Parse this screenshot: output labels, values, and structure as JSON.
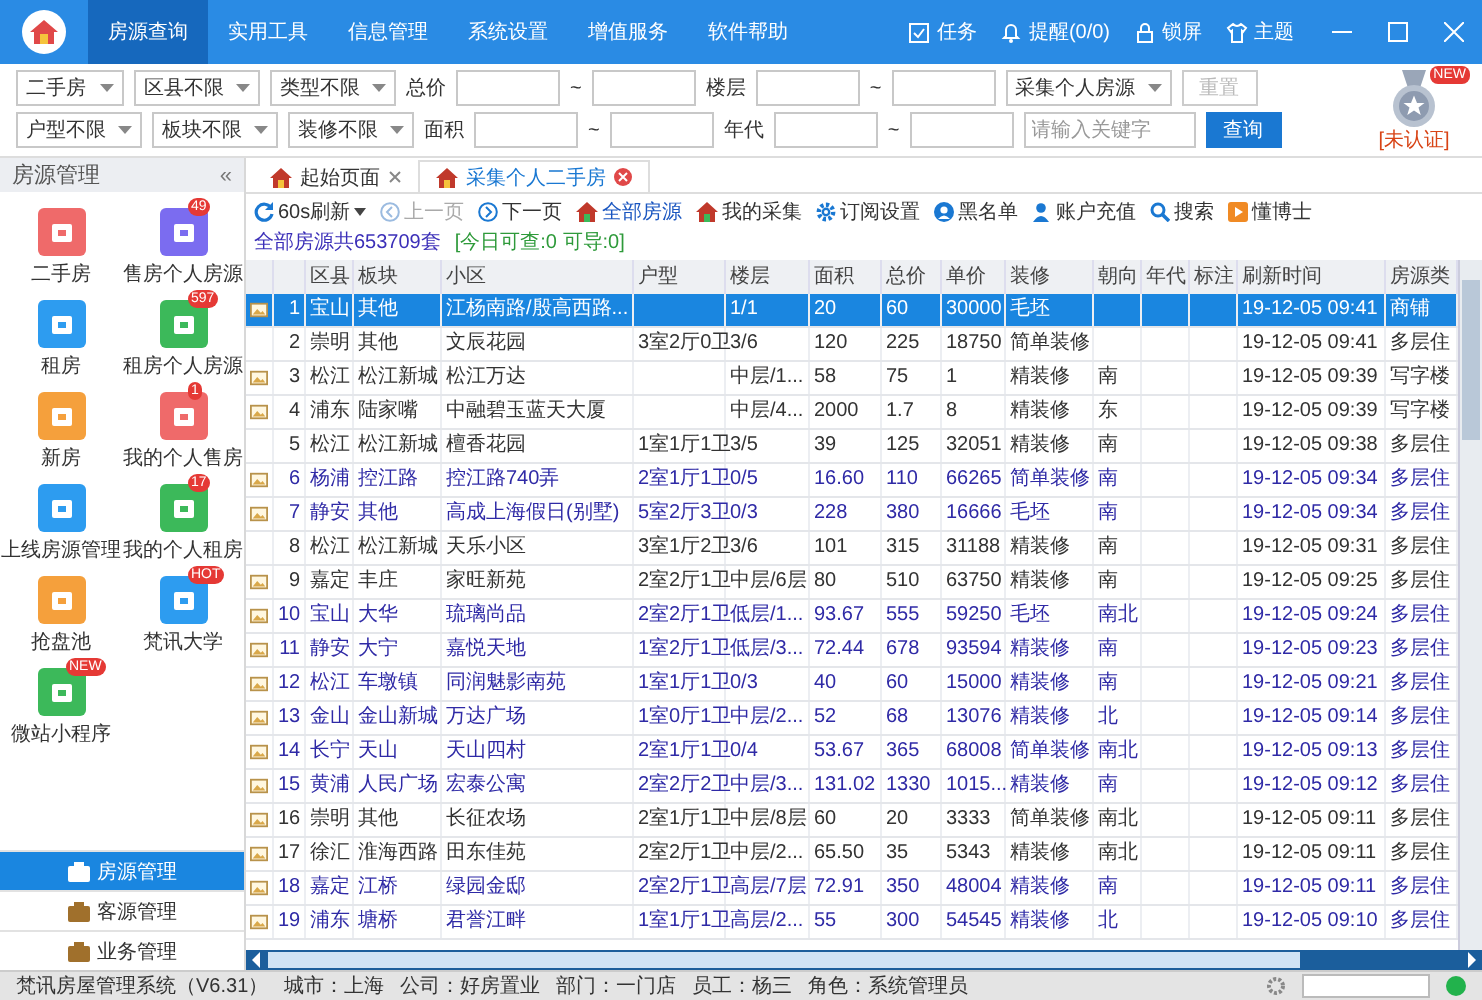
{
  "title_bar": {
    "menu": [
      {
        "label": "房源查询",
        "selected": true
      },
      {
        "label": "实用工具",
        "selected": false
      },
      {
        "label": "信息管理",
        "selected": false
      },
      {
        "label": "系统设置",
        "selected": false
      },
      {
        "label": "增值服务",
        "selected": false
      },
      {
        "label": "软件帮助",
        "selected": false
      }
    ],
    "actions": [
      {
        "kind": "task",
        "label": "任务"
      },
      {
        "kind": "bell",
        "label": "提醒(0/0)"
      },
      {
        "kind": "lock",
        "label": "锁屏"
      },
      {
        "kind": "shirt",
        "label": "主题"
      }
    ]
  },
  "filters": {
    "rows": [
      [
        {
          "kind": "select",
          "value": "二手房"
        },
        {
          "kind": "select",
          "value": "区县不限"
        },
        {
          "kind": "select",
          "value": "类型不限"
        },
        {
          "kind": "label",
          "value": "总价"
        },
        {
          "kind": "input"
        },
        {
          "kind": "tilde",
          "value": "~"
        },
        {
          "kind": "input"
        },
        {
          "kind": "label",
          "value": "楼层"
        },
        {
          "kind": "input"
        },
        {
          "kind": "tilde",
          "value": "~"
        },
        {
          "kind": "input"
        },
        {
          "kind": "select",
          "value": "采集个人房源"
        },
        {
          "kind": "button",
          "value": "重置",
          "disabled": true
        }
      ],
      [
        {
          "kind": "select",
          "value": "户型不限"
        },
        {
          "kind": "select",
          "value": "板块不限"
        },
        {
          "kind": "select",
          "value": "装修不限"
        },
        {
          "kind": "label",
          "value": "面积"
        },
        {
          "kind": "input"
        },
        {
          "kind": "tilde",
          "value": "~"
        },
        {
          "kind": "input"
        },
        {
          "kind": "label",
          "value": "年代"
        },
        {
          "kind": "input"
        },
        {
          "kind": "tilde",
          "value": "~"
        },
        {
          "kind": "input"
        },
        {
          "kind": "input",
          "placeholder": "请输入关键字"
        },
        {
          "kind": "button",
          "value": "查询",
          "disabled": false
        }
      ]
    ]
  },
  "certification": {
    "badge": "NEW",
    "status": "[未认证]"
  },
  "sidebar": {
    "title": "房源管理",
    "collapse": "«",
    "items": [
      {
        "label": "二手房",
        "color": "#ef6a6a"
      },
      {
        "label": "售房个人房源",
        "color": "#7b6cf0",
        "badge": "49"
      },
      {
        "label": "租房",
        "color": "#2d9cf0"
      },
      {
        "label": "租房个人房源",
        "color": "#3cb95a",
        "badge": "597"
      },
      {
        "label": "新房",
        "color": "#f5a03c"
      },
      {
        "label": "我的个人售房",
        "color": "#ef6a6a",
        "badge": "1"
      },
      {
        "label": "上线房源管理",
        "color": "#2d9cf0"
      },
      {
        "label": "我的个人租房",
        "color": "#3cb95a",
        "badge": "17"
      },
      {
        "label": "抢盘池",
        "color": "#f5a03c"
      },
      {
        "label": "梵讯大学",
        "color": "#2d9cf0",
        "badge": "HOT"
      },
      {
        "label": "微站小程序",
        "color": "#3cb95a",
        "badge": "NEW"
      }
    ],
    "nav": [
      {
        "label": "房源管理",
        "selected": true
      },
      {
        "label": "客源管理",
        "selected": false
      },
      {
        "label": "业务管理",
        "selected": false
      }
    ]
  },
  "tabs": [
    {
      "label": "起始页面",
      "selected": false
    },
    {
      "label": "采集个人二手房",
      "selected": true
    }
  ],
  "toolbar": {
    "items": [
      {
        "kind": "refresh",
        "label": "60s刷新",
        "disabled": false
      },
      {
        "kind": "prev",
        "label": "上一页",
        "disabled": true
      },
      {
        "kind": "next",
        "label": "下一页",
        "disabled": false
      },
      {
        "kind": "home",
        "label": "全部房源",
        "disabled": false,
        "accent": true
      },
      {
        "kind": "home",
        "label": "我的采集",
        "disabled": false
      },
      {
        "kind": "gear",
        "label": "订阅设置",
        "disabled": false
      },
      {
        "kind": "block",
        "label": "黑名单",
        "disabled": false
      },
      {
        "kind": "user",
        "label": "账户充值",
        "disabled": false
      },
      {
        "kind": "search",
        "label": "搜索",
        "disabled": false
      },
      {
        "kind": "play",
        "label": "懂博士",
        "disabled": false
      }
    ],
    "summary": "全部房源共653709套",
    "quota": "[今日可查:0 可导:0]"
  },
  "table": {
    "columns": [
      "区县",
      "板块",
      "小区",
      "户型",
      "楼层",
      "面积",
      "总价",
      "单价",
      "装修",
      "朝向",
      "年代",
      "标注",
      "刷新时间",
      "房源类"
    ],
    "rows": [
      {
        "no": "1",
        "has_photo": true,
        "highlighted": true,
        "selected": true,
        "cells": [
          "宝山",
          "其他",
          "江杨南路/殷高西路...",
          "",
          "1/1",
          "20",
          "60",
          "30000",
          "毛坯",
          "",
          "",
          "",
          "19-12-05 09:41",
          "商铺"
        ]
      },
      {
        "no": "2",
        "has_photo": false,
        "highlighted": false,
        "selected": false,
        "cells": [
          "崇明",
          "其他",
          "文辰花园",
          "3室2厅0卫",
          "3/6",
          "120",
          "225",
          "18750",
          "简单装修",
          "",
          "",
          "",
          "19-12-05 09:41",
          "多层住"
        ]
      },
      {
        "no": "3",
        "has_photo": true,
        "highlighted": false,
        "selected": false,
        "cells": [
          "松江",
          "松江新城",
          "松江万达",
          "",
          "中层/1...",
          "58",
          "75",
          "1",
          "精装修",
          "南",
          "",
          "",
          "19-12-05 09:39",
          "写字楼"
        ]
      },
      {
        "no": "4",
        "has_photo": true,
        "highlighted": false,
        "selected": false,
        "cells": [
          "浦东",
          "陆家嘴",
          "中融碧玉蓝天大厦",
          "",
          "中层/4...",
          "2000",
          "1.7",
          "8",
          "精装修",
          "东",
          "",
          "",
          "19-12-05 09:39",
          "写字楼"
        ]
      },
      {
        "no": "5",
        "has_photo": false,
        "highlighted": false,
        "selected": false,
        "cells": [
          "松江",
          "松江新城",
          "檀香花园",
          "1室1厅1卫",
          "3/5",
          "39",
          "125",
          "32051",
          "精装修",
          "南",
          "",
          "",
          "19-12-05 09:38",
          "多层住"
        ]
      },
      {
        "no": "6",
        "has_photo": true,
        "highlighted": true,
        "selected": false,
        "cells": [
          "杨浦",
          "控江路",
          "控江路740弄",
          "2室1厅1卫",
          "0/5",
          "16.60",
          "110",
          "66265",
          "简单装修",
          "南",
          "",
          "",
          "19-12-05 09:34",
          "多层住"
        ]
      },
      {
        "no": "7",
        "has_photo": true,
        "highlighted": true,
        "selected": false,
        "cells": [
          "静安",
          "其他",
          "高成上海假日(别墅)",
          "5室2厅3卫",
          "0/3",
          "228",
          "380",
          "16666",
          "毛坯",
          "南",
          "",
          "",
          "19-12-05 09:34",
          "多层住"
        ]
      },
      {
        "no": "8",
        "has_photo": false,
        "highlighted": false,
        "selected": false,
        "cells": [
          "松江",
          "松江新城",
          "天乐小区",
          "3室1厅2卫",
          "3/6",
          "101",
          "315",
          "31188",
          "精装修",
          "南",
          "",
          "",
          "19-12-05 09:31",
          "多层住"
        ]
      },
      {
        "no": "9",
        "has_photo": true,
        "highlighted": false,
        "selected": false,
        "cells": [
          "嘉定",
          "丰庄",
          "家旺新苑",
          "2室2厅1卫",
          "中层/6层",
          "80",
          "510",
          "63750",
          "精装修",
          "南",
          "",
          "",
          "19-12-05 09:25",
          "多层住"
        ]
      },
      {
        "no": "10",
        "has_photo": true,
        "highlighted": true,
        "selected": false,
        "cells": [
          "宝山",
          "大华",
          "琉璃尚品",
          "2室2厅1卫",
          "低层/1...",
          "93.67",
          "555",
          "59250",
          "毛坯",
          "南北",
          "",
          "",
          "19-12-05 09:24",
          "多层住"
        ]
      },
      {
        "no": "11",
        "has_photo": true,
        "highlighted": true,
        "selected": false,
        "cells": [
          "静安",
          "大宁",
          "嘉悦天地",
          "1室2厅1卫",
          "低层/3...",
          "72.44",
          "678",
          "93594",
          "精装修",
          "南",
          "",
          "",
          "19-12-05 09:23",
          "多层住"
        ]
      },
      {
        "no": "12",
        "has_photo": true,
        "highlighted": true,
        "selected": false,
        "cells": [
          "松江",
          "车墩镇",
          "同润魅影南苑",
          "1室1厅1卫",
          "0/3",
          "40",
          "60",
          "15000",
          "精装修",
          "南",
          "",
          "",
          "19-12-05 09:21",
          "多层住"
        ]
      },
      {
        "no": "13",
        "has_photo": true,
        "highlighted": true,
        "selected": false,
        "cells": [
          "金山",
          "金山新城",
          "万达广场",
          "1室0厅1卫",
          "中层/2...",
          "52",
          "68",
          "13076",
          "精装修",
          "北",
          "",
          "",
          "19-12-05 09:14",
          "多层住"
        ]
      },
      {
        "no": "14",
        "has_photo": true,
        "highlighted": true,
        "selected": false,
        "cells": [
          "长宁",
          "天山",
          "天山四村",
          "2室1厅1卫",
          "0/4",
          "53.67",
          "365",
          "68008",
          "简单装修",
          "南北",
          "",
          "",
          "19-12-05 09:13",
          "多层住"
        ]
      },
      {
        "no": "15",
        "has_photo": true,
        "highlighted": true,
        "selected": false,
        "cells": [
          "黄浦",
          "人民广场",
          "宏泰公寓",
          "2室2厅2卫",
          "中层/3...",
          "131.02",
          "1330",
          "1015...",
          "精装修",
          "南",
          "",
          "",
          "19-12-05 09:12",
          "多层住"
        ]
      },
      {
        "no": "16",
        "has_photo": true,
        "highlighted": false,
        "selected": false,
        "cells": [
          "崇明",
          "其他",
          "长征农场",
          "2室1厅1卫",
          "中层/8层",
          "60",
          "20",
          "3333",
          "简单装修",
          "南北",
          "",
          "",
          "19-12-05 09:11",
          "多层住"
        ]
      },
      {
        "no": "17",
        "has_photo": true,
        "highlighted": false,
        "selected": false,
        "cells": [
          "徐汇",
          "淮海西路",
          "田东佳苑",
          "2室2厅1卫",
          "中层/2...",
          "65.50",
          "35",
          "5343",
          "精装修",
          "南北",
          "",
          "",
          "19-12-05 09:11",
          "多层住"
        ]
      },
      {
        "no": "18",
        "has_photo": true,
        "highlighted": true,
        "selected": false,
        "cells": [
          "嘉定",
          "江桥",
          "绿园金邸",
          "2室2厅1卫",
          "高层/7层",
          "72.91",
          "350",
          "48004",
          "精装修",
          "南",
          "",
          "",
          "19-12-05 09:11",
          "多层住"
        ]
      },
      {
        "no": "19",
        "has_photo": true,
        "highlighted": true,
        "selected": false,
        "cells": [
          "浦东",
          "塘桥",
          "君誉江畔",
          "1室1厅1卫",
          "高层/2...",
          "55",
          "300",
          "54545",
          "精装修",
          "北",
          "",
          "",
          "19-12-05 09:10",
          "多层住"
        ]
      }
    ]
  },
  "status_bar": {
    "items": [
      "梵讯房屋管理系统（V6.31）",
      "城市：上海",
      "公司：好房置业",
      "部门：一门店",
      "员工：杨三",
      "角色：系统管理员"
    ],
    "online": true
  }
}
